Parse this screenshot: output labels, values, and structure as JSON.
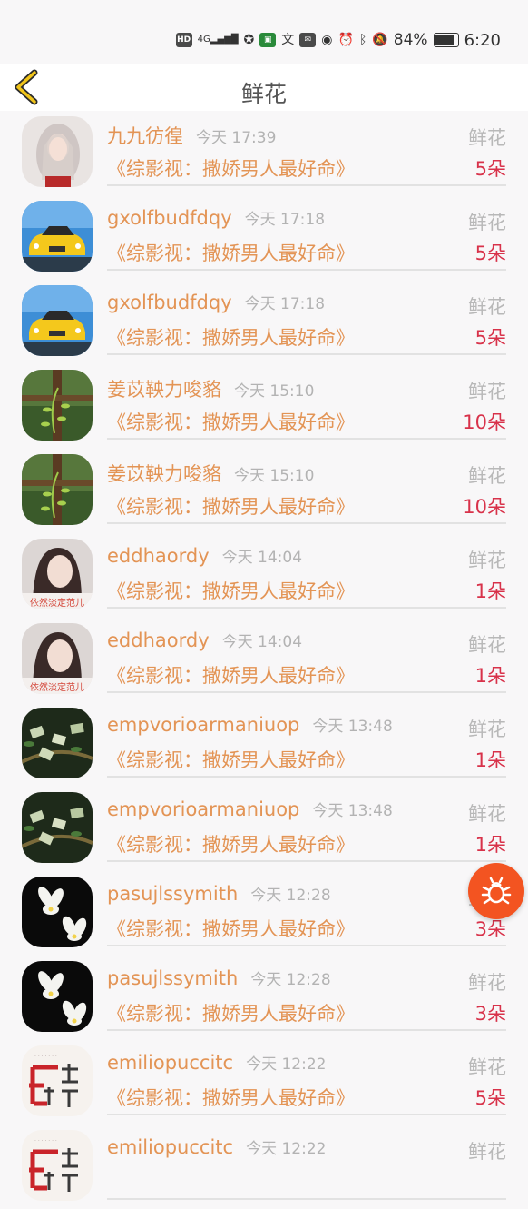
{
  "status_bar": {
    "hd": "HD",
    "signal": "4G",
    "battery_percent": "84%",
    "time": "6:20"
  },
  "header": {
    "title": "鲜花",
    "back_icon": "chevron-left-icon"
  },
  "gift_records": [
    {
      "username": "九九彷徨",
      "time": "今天 17:39",
      "gift": "鲜花",
      "book": "《综影视：撒娇男人最好命》",
      "count": "5朵",
      "avatar": "girl-portrait"
    },
    {
      "username": "gxolfbudfdqy",
      "time": "今天 17:18",
      "gift": "鲜花",
      "book": "《综影视：撒娇男人最好命》",
      "count": "5朵",
      "avatar": "yellow-car"
    },
    {
      "username": "gxolfbudfdqy",
      "time": "今天 17:18",
      "gift": "鲜花",
      "book": "《综影视：撒娇男人最好命》",
      "count": "5朵",
      "avatar": "yellow-car"
    },
    {
      "username": "姜苡鞅力唆貉",
      "time": "今天 15:10",
      "gift": "鲜花",
      "book": "《综影视：撒娇男人最好命》",
      "count": "10朵",
      "avatar": "green-vine"
    },
    {
      "username": "姜苡鞅力唆貉",
      "time": "今天 15:10",
      "gift": "鲜花",
      "book": "《综影视：撒娇男人最好命》",
      "count": "10朵",
      "avatar": "green-vine"
    },
    {
      "username": "eddhaordy",
      "time": "今天 14:04",
      "gift": "鲜花",
      "book": "《综影视：撒娇男人最好命》",
      "count": "1朵",
      "avatar": "girl-caption"
    },
    {
      "username": "eddhaordy",
      "time": "今天 14:04",
      "gift": "鲜花",
      "book": "《综影视：撒娇男人最好命》",
      "count": "1朵",
      "avatar": "girl-caption"
    },
    {
      "username": "empvorioarmaniuop",
      "time": "今天 13:48",
      "gift": "鲜花",
      "book": "《综影视：撒娇男人最好命》",
      "count": "1朵",
      "avatar": "money-tree"
    },
    {
      "username": "empvorioarmaniuop",
      "time": "今天 13:48",
      "gift": "鲜花",
      "book": "《综影视：撒娇男人最好命》",
      "count": "1朵",
      "avatar": "money-tree"
    },
    {
      "username": "pasujlssymith",
      "time": "今天 12:28",
      "gift": "鲜花",
      "book": "《综影视：撒娇男人最好命》",
      "count": "3朵",
      "avatar": "white-orchid"
    },
    {
      "username": "pasujlssymith",
      "time": "今天 12:28",
      "gift": "鲜花",
      "book": "《综影视：撒娇男人最好命》",
      "count": "3朵",
      "avatar": "white-orchid"
    },
    {
      "username": "emiliopuccitc",
      "time": "今天 12:22",
      "gift": "鲜花",
      "book": "《综影视：撒娇男人最好命》",
      "count": "5朵",
      "avatar": "calligraphy"
    },
    {
      "username": "emiliopuccitc",
      "time": "今天 12:22",
      "gift": "鲜花",
      "book": "",
      "count": "",
      "avatar": "calligraphy"
    }
  ],
  "avatar_captions": {
    "girl-caption": "依然淡定范儿"
  },
  "debug_button": {
    "icon": "bug-icon"
  },
  "colors": {
    "accent_orange": "#e39455",
    "count_red": "#d8324a",
    "fab_orange": "#f35421",
    "back_yellow": "#f0c419"
  }
}
